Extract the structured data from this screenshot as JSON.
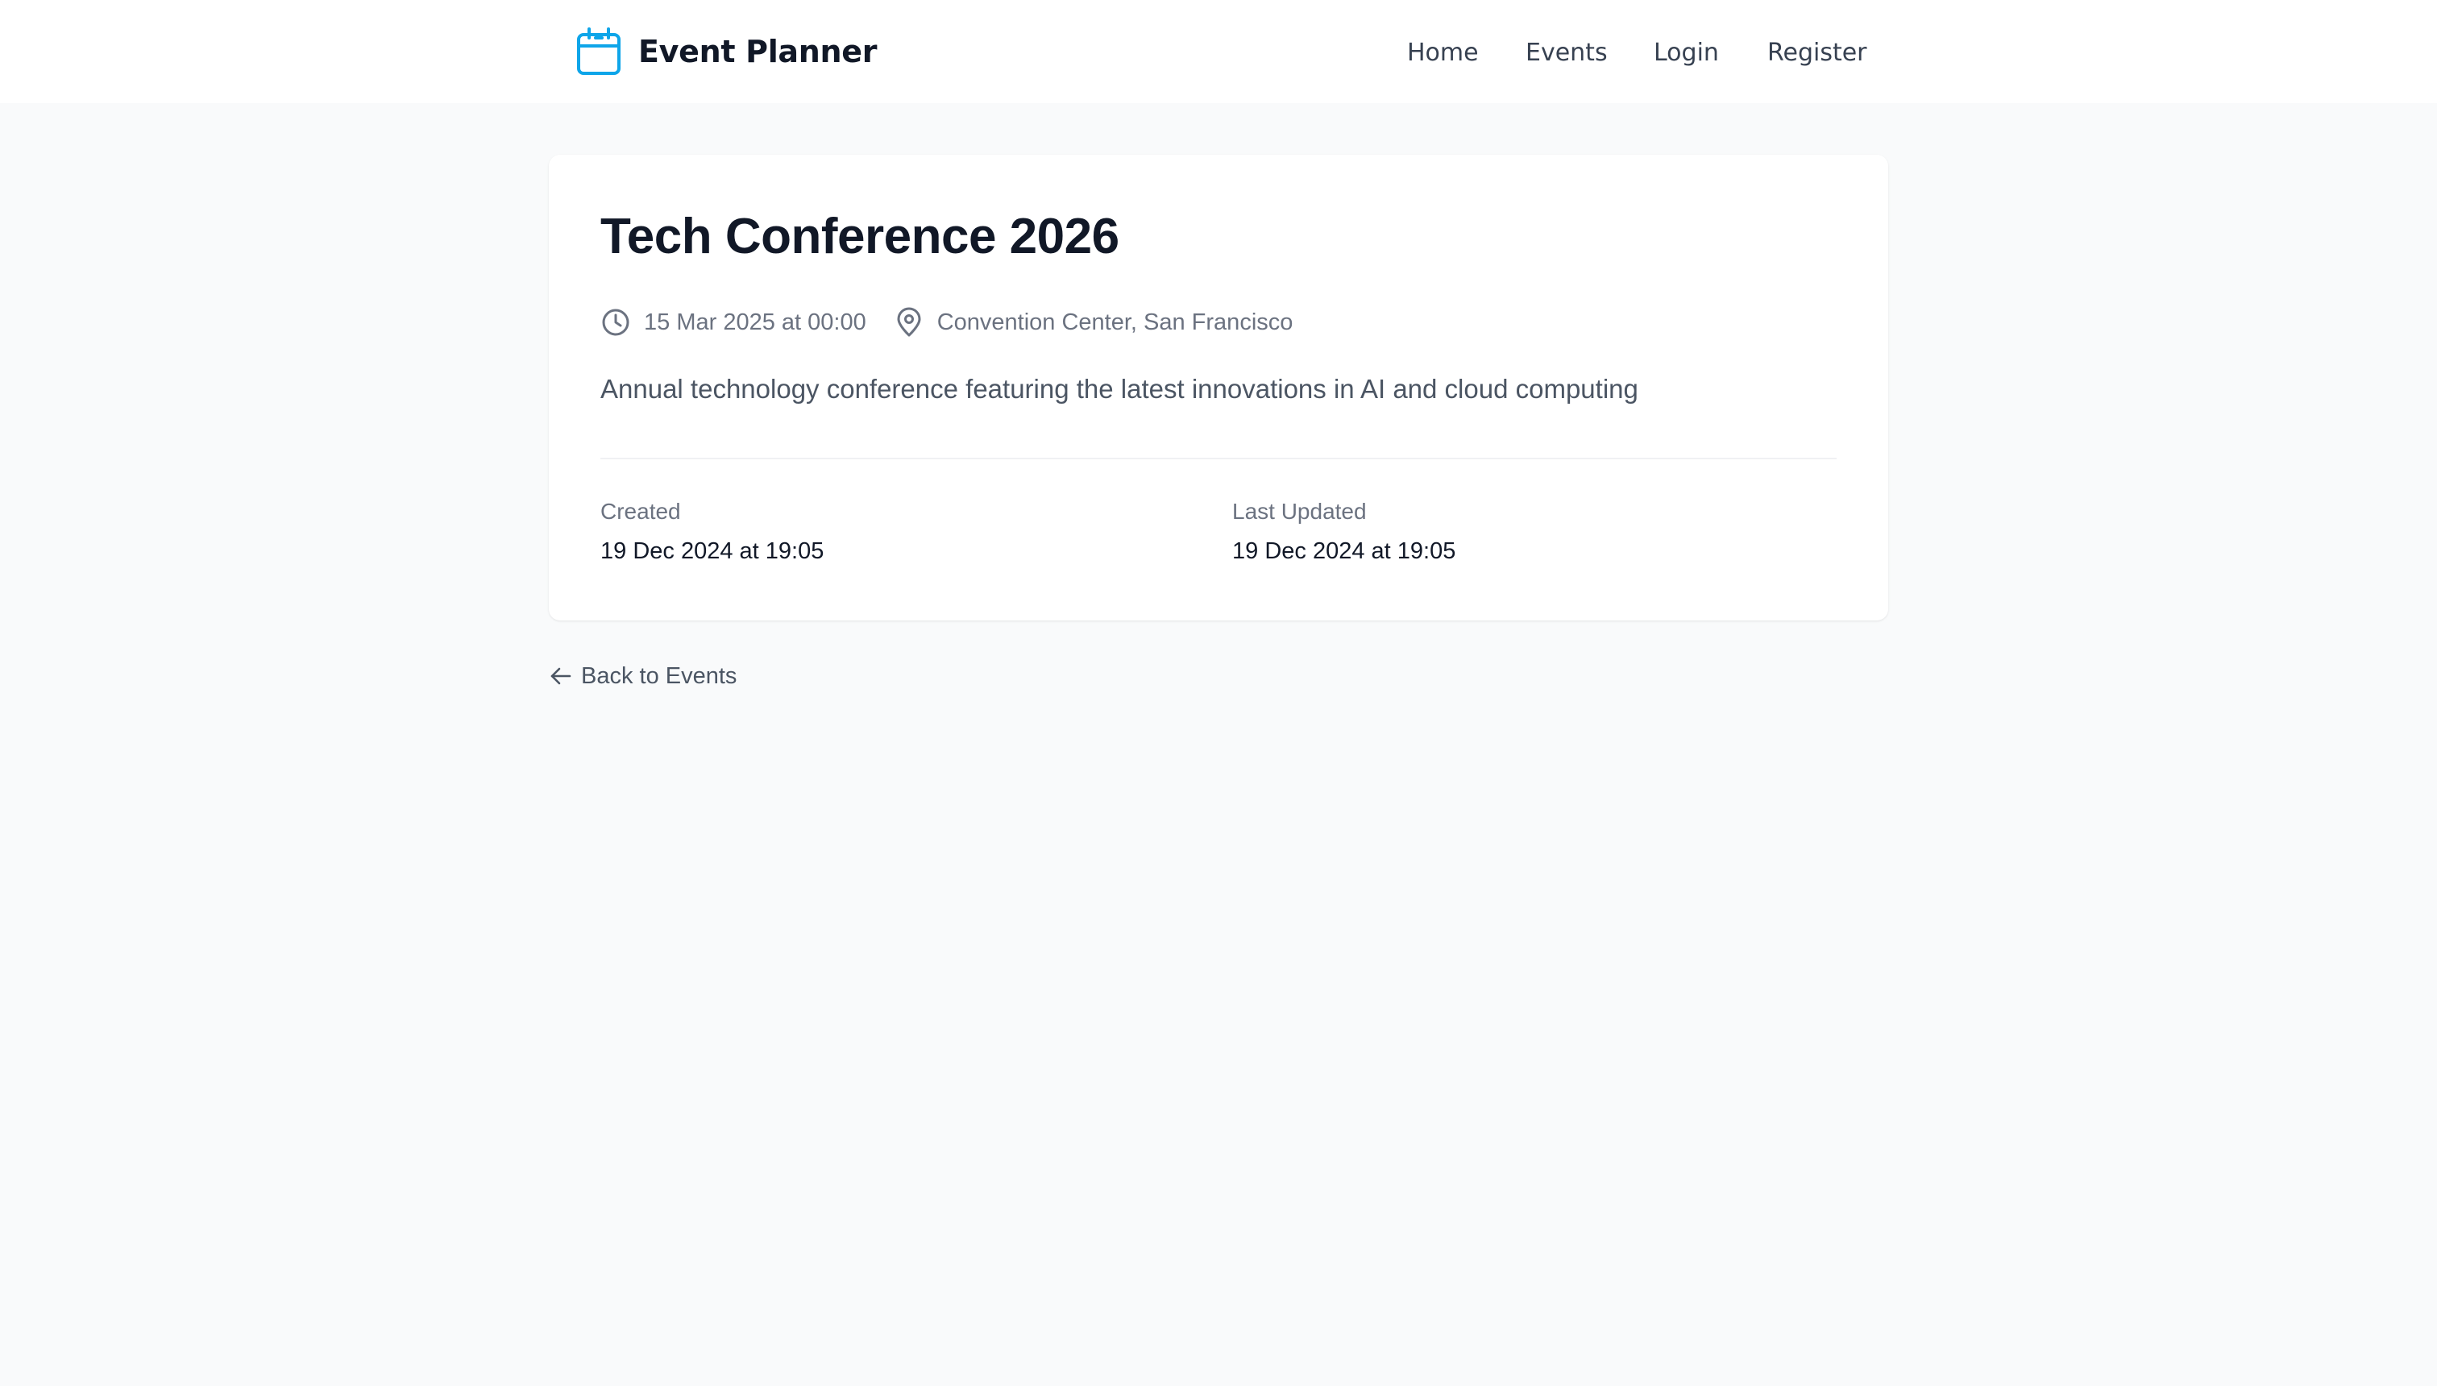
{
  "navbar": {
    "brand": {
      "name": "Event Planner",
      "icon": "calendar-icon",
      "icon_color": "#0ea5e9"
    },
    "links": [
      {
        "label": "Home"
      },
      {
        "label": "Events"
      },
      {
        "label": "Login"
      },
      {
        "label": "Register"
      }
    ]
  },
  "event": {
    "title": "Tech Conference 2026",
    "datetime": "15 Mar 2025 at 00:00",
    "datetime_icon": "clock-icon",
    "location": "Convention Center, San Francisco",
    "location_icon": "map-pin-icon",
    "description": "Annual technology conference featuring the latest innovations in AI and cloud computing",
    "created": {
      "label": "Created",
      "value": "19 Dec 2024 at 19:05"
    },
    "updated": {
      "label": "Last Updated",
      "value": "19 Dec 2024 at 19:05"
    }
  },
  "back_link": {
    "label": "Back to Events",
    "icon": "arrow-left-icon"
  },
  "colors": {
    "page_background": "#f9fafb",
    "card_background": "#ffffff",
    "title_text": "#111827",
    "muted_text": "#6b7280",
    "accent": "#0ea5e9"
  }
}
